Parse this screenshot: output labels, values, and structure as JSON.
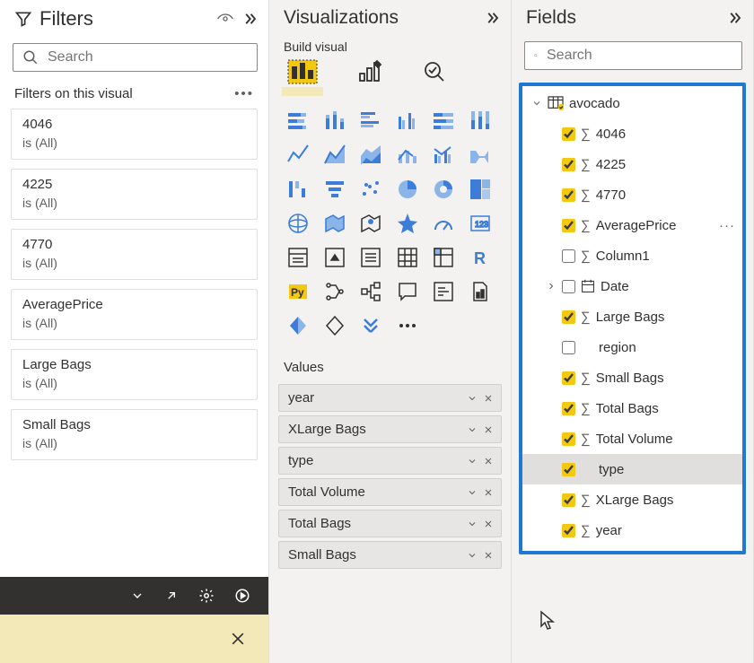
{
  "filters": {
    "title": "Filters",
    "search_placeholder": "Search",
    "section": "Filters on this visual",
    "cards": [
      {
        "name": "4046",
        "state": "is (All)"
      },
      {
        "name": "4225",
        "state": "is (All)"
      },
      {
        "name": "4770",
        "state": "is (All)"
      },
      {
        "name": "AveragePrice",
        "state": "is (All)"
      },
      {
        "name": "Large Bags",
        "state": "is (All)"
      },
      {
        "name": "Small Bags",
        "state": "is (All)"
      }
    ]
  },
  "viz": {
    "title": "Visualizations",
    "build": "Build visual",
    "values_label": "Values",
    "values": [
      "year",
      "XLarge Bags",
      "type",
      "Total Volume",
      "Total Bags",
      "Small Bags"
    ]
  },
  "fields": {
    "title": "Fields",
    "search_placeholder": "Search",
    "table": "avocado",
    "items": [
      {
        "label": "4046",
        "checked": true,
        "sigma": true
      },
      {
        "label": "4225",
        "checked": true,
        "sigma": true
      },
      {
        "label": "4770",
        "checked": true,
        "sigma": true
      },
      {
        "label": "AveragePrice",
        "checked": true,
        "sigma": true,
        "more": true
      },
      {
        "label": "Column1",
        "checked": false,
        "sigma": true
      },
      {
        "label": "Date",
        "checked": false,
        "date": true,
        "expandable": true
      },
      {
        "label": "Large Bags",
        "checked": true,
        "sigma": true
      },
      {
        "label": "region",
        "checked": false
      },
      {
        "label": "Small Bags",
        "checked": true,
        "sigma": true
      },
      {
        "label": "Total Bags",
        "checked": true,
        "sigma": true
      },
      {
        "label": "Total Volume",
        "checked": true,
        "sigma": true
      },
      {
        "label": "type",
        "checked": true,
        "selected": true
      },
      {
        "label": "XLarge Bags",
        "checked": true,
        "sigma": true
      },
      {
        "label": "year",
        "checked": true,
        "sigma": true
      }
    ]
  }
}
